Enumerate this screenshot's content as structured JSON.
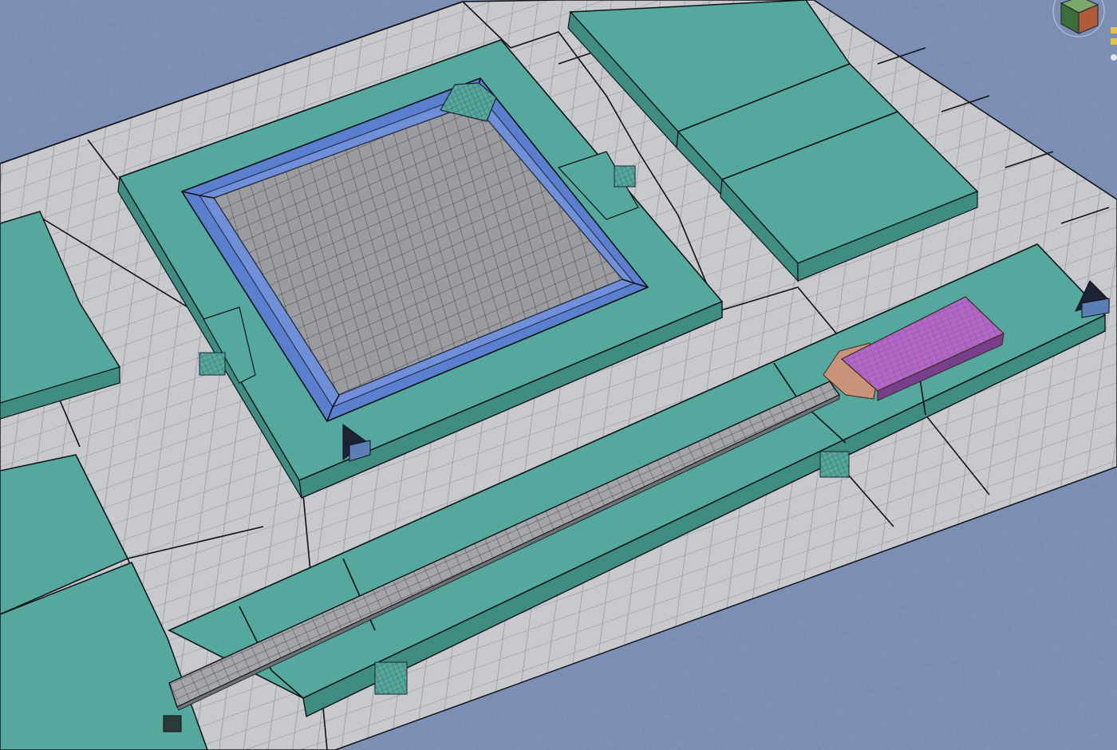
{
  "viewport": {
    "background": "#7b8fb4",
    "colors": {
      "ground_grid": "#9aa3b6",
      "tile": "#c8c9cc",
      "tile_line": "#858892",
      "slab_top": "#55a89d",
      "slab_side": "#3f8c82",
      "pool_rim": "#5b7fcf",
      "pool_floor": "#9a9c9f",
      "walkway": "#a3a5a8",
      "roof": "#b168c6",
      "roof_base": "#c9937a",
      "marker": "#1c2333",
      "marker_face": "#5a7fb6"
    }
  },
  "scene_objects": [
    {
      "name": "ground-plane-grid"
    },
    {
      "name": "paving-tiles"
    },
    {
      "name": "central-plaza-slab"
    },
    {
      "name": "reflecting-pool"
    },
    {
      "name": "pool-corner-stairs"
    },
    {
      "name": "right-upper-slabs"
    },
    {
      "name": "long-platform-slab"
    },
    {
      "name": "long-walkway"
    },
    {
      "name": "roofed-structure"
    },
    {
      "name": "left-slabs"
    },
    {
      "name": "camera-markers"
    },
    {
      "name": "step-blocks"
    }
  ],
  "nav_cube": {
    "icon": "view-cube-icon"
  }
}
